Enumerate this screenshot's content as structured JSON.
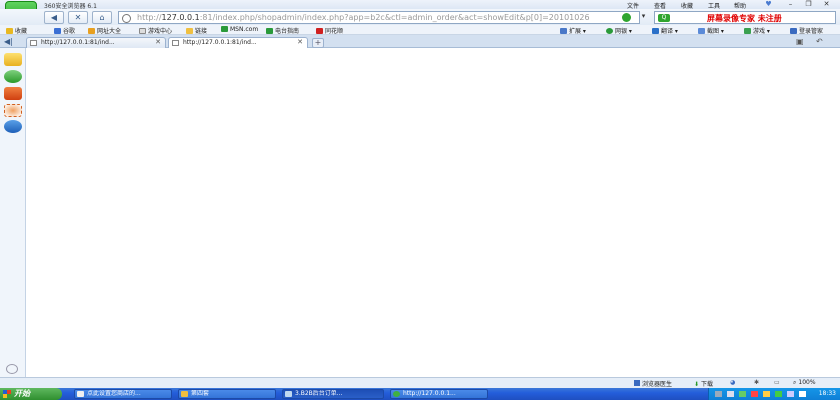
{
  "window": {
    "title": "360安全浏览器 6.1",
    "menu": [
      "文件",
      "查看",
      "收藏",
      "工具",
      "帮助"
    ]
  },
  "address_bar": {
    "url_prefix": "http://",
    "url_host": "127.0.0.1",
    "url_rest": ":81/index.php/shopadmin/index.php?app=b2c&ctl=admin_order&act=showEdit&p[0]=20101026"
  },
  "search": {
    "overlay_text": "屏幕录像专家  未注册"
  },
  "favorites": [
    {
      "label": "收藏",
      "icon": "star-icon"
    },
    {
      "label": "谷歌",
      "icon": "google-icon"
    },
    {
      "label": "网址大全",
      "icon": "nav-icon"
    },
    {
      "label": "游戏中心",
      "icon": "game-icon"
    },
    {
      "label": "链接",
      "icon": "folder-icon"
    },
    {
      "label": "MSN.com",
      "icon": "msn-icon"
    },
    {
      "label": "电台指南",
      "icon": "radio-icon"
    },
    {
      "label": "同花顺",
      "icon": "stock-icon"
    }
  ],
  "toolbar_right": [
    {
      "label": "扩展",
      "icon": "extension-icon"
    },
    {
      "label": "网银",
      "icon": "bank-icon"
    },
    {
      "label": "翻译",
      "icon": "translate-icon"
    },
    {
      "label": "截图",
      "icon": "screenshot-icon"
    },
    {
      "label": "游戏",
      "icon": "game-icon"
    },
    {
      "label": "登录管家",
      "icon": "login-icon"
    }
  ],
  "tabs": [
    {
      "label": "http://127.0.0.1:81/ind...",
      "active": false
    },
    {
      "label": "http://127.0.0.1:81/ind...",
      "active": true
    }
  ],
  "statusbar": {
    "doctor": "浏览器医生",
    "download": "下载",
    "zoom": "100%"
  },
  "taskbar": {
    "start": "开始",
    "tasks": [
      {
        "label": "点此设置您商店的...",
        "active": false
      },
      {
        "label": "第四套",
        "active": false
      },
      {
        "label": "3.B2B后台订单...",
        "active": true
      },
      {
        "label": "http://127.0.0.1...",
        "active": false
      }
    ],
    "clock": "18:33"
  }
}
